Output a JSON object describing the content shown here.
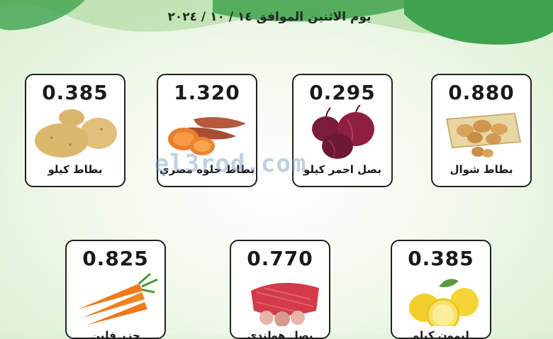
{
  "header": {
    "date_text": "يوم الاثنين الموافق ١٤ / ١٠ / ٢٠٢٤",
    "wave_colors": [
      "#3fa34d",
      "#a8d89a"
    ]
  },
  "watermark": {
    "text": "el3rod.com"
  },
  "products": [
    {
      "price": "0.880",
      "name": "بطاط شوال",
      "icon": "potato-sack-icon"
    },
    {
      "price": "0.295",
      "name": "بصل احمر كيلو",
      "icon": "red-onion-icon"
    },
    {
      "price": "1.320",
      "name": "بطاط حلوه مصري",
      "icon": "sweet-potato-icon"
    },
    {
      "price": "0.385",
      "name": "بطاط كيلو",
      "icon": "potato-icon"
    },
    {
      "price": "0.385",
      "name": "ليمون كيلو",
      "icon": "lemon-icon"
    },
    {
      "price": "0.770",
      "name": "بصل هولندي",
      "icon": "onion-bag-icon"
    },
    {
      "price": "0.825",
      "name": "جزر فلين",
      "icon": "carrot-icon"
    }
  ]
}
